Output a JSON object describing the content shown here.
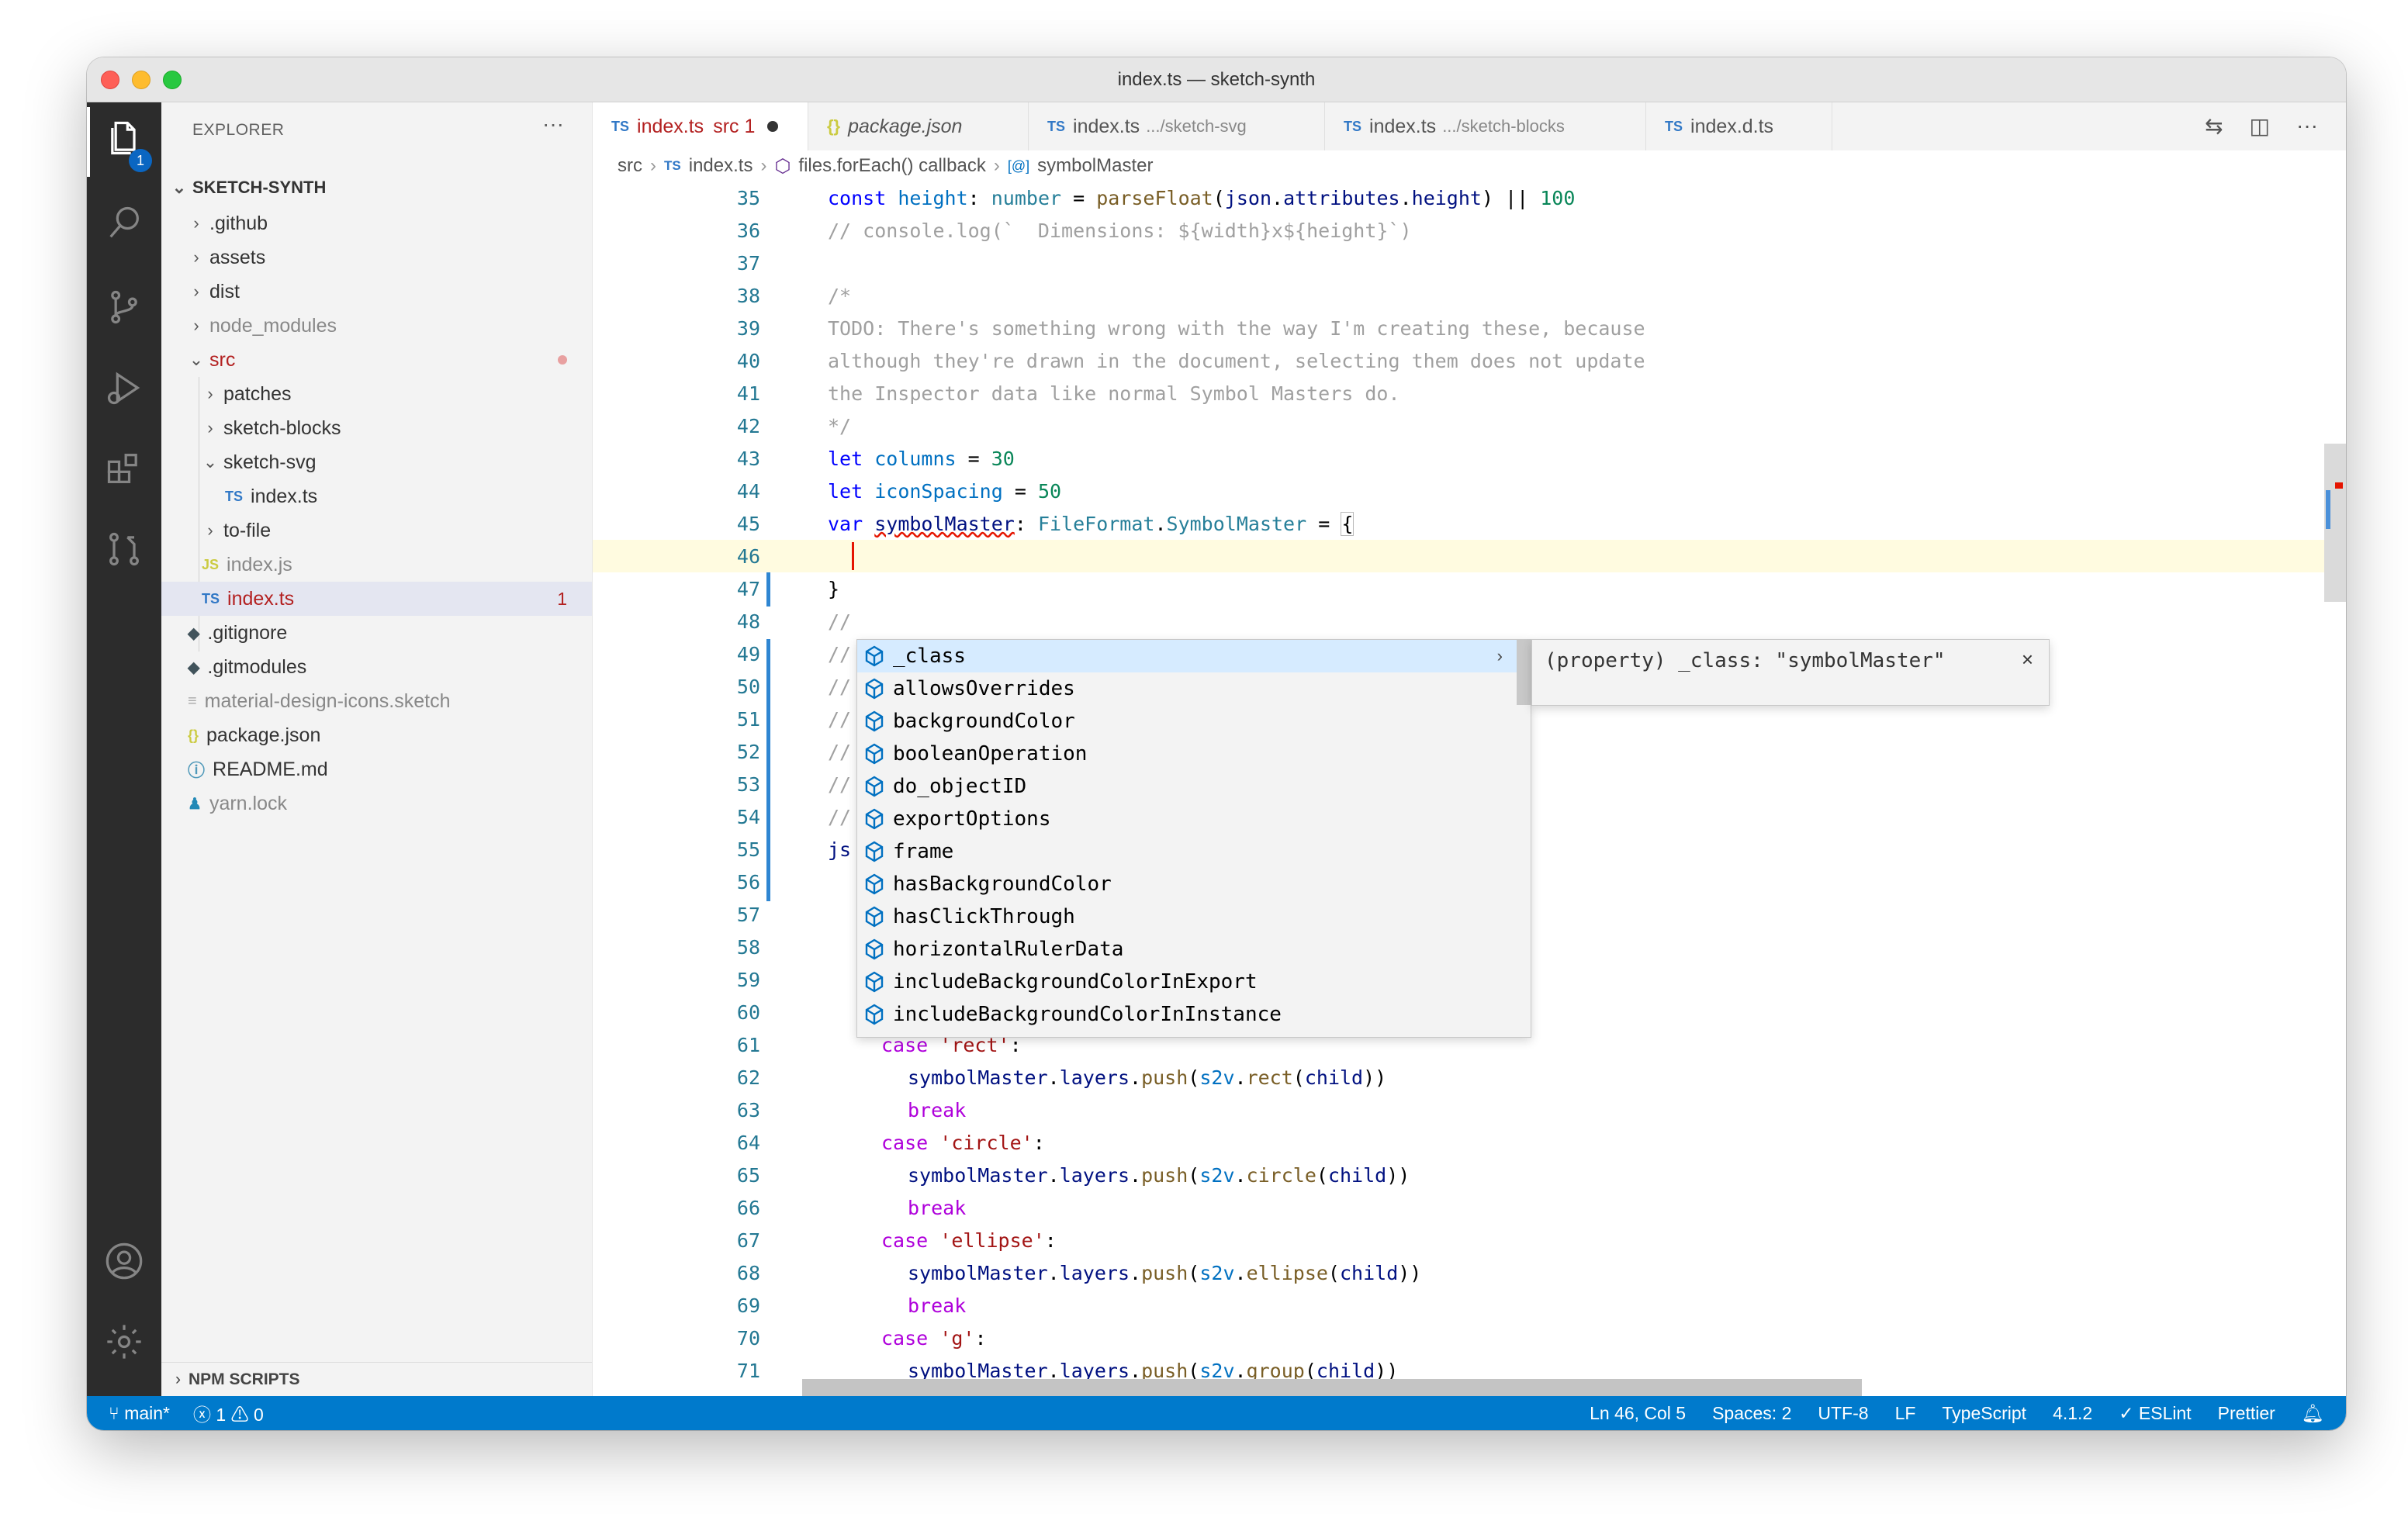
{
  "window": {
    "title": "index.ts — sketch-synth"
  },
  "activity_bar": {
    "explorer_badge": "1"
  },
  "sidebar": {
    "header": "EXPLORER",
    "more": "···",
    "workspace": "SKETCH-SYNTH",
    "tree": [
      {
        "label": ".github",
        "kind": "folder"
      },
      {
        "label": "assets",
        "kind": "folder"
      },
      {
        "label": "dist",
        "kind": "folder"
      },
      {
        "label": "node_modules",
        "kind": "folder"
      },
      {
        "label": "src",
        "kind": "folder-open"
      },
      {
        "label": "patches",
        "kind": "folder"
      },
      {
        "label": "sketch-blocks",
        "kind": "folder"
      },
      {
        "label": "sketch-svg",
        "kind": "folder-open"
      },
      {
        "label": "index.ts",
        "kind": "ts"
      },
      {
        "label": "to-file",
        "kind": "folder"
      },
      {
        "label": "index.js",
        "kind": "js"
      },
      {
        "label": "index.ts",
        "kind": "ts",
        "problems": "1"
      },
      {
        "label": ".gitignore",
        "kind": "git"
      },
      {
        "label": ".gitmodules",
        "kind": "git"
      },
      {
        "label": "material-design-icons.sketch",
        "kind": "file"
      },
      {
        "label": "package.json",
        "kind": "json"
      },
      {
        "label": "README.md",
        "kind": "info"
      },
      {
        "label": "yarn.lock",
        "kind": "yarn"
      }
    ],
    "npm_scripts": "NPM SCRIPTS"
  },
  "tabs": [
    {
      "icon": "TS",
      "label": "index.ts",
      "detail": "src 1",
      "active": true
    },
    {
      "icon": "{}",
      "label": "package.json",
      "detail": ""
    },
    {
      "icon": "TS",
      "label": "index.ts",
      "detail": ".../sketch-svg"
    },
    {
      "icon": "TS",
      "label": "index.ts",
      "detail": ".../sketch-blocks"
    },
    {
      "icon": "TS",
      "label": "index.d.ts",
      "detail": ""
    }
  ],
  "breadcrumb": {
    "items": [
      "src",
      "index.ts",
      "files.forEach() callback",
      "symbolMaster"
    ],
    "ts_icon": "TS"
  },
  "code": {
    "line_numbers": [
      "35",
      "36",
      "37",
      "38",
      "39",
      "40",
      "41",
      "42",
      "43",
      "44",
      "45",
      "46",
      "47",
      "48",
      "49",
      "50",
      "51",
      "52",
      "53",
      "54",
      "55",
      "56",
      "57",
      "58",
      "59",
      "60",
      "61",
      "62",
      "63",
      "64",
      "65",
      "66",
      "67",
      "68",
      "69",
      "70",
      "71"
    ],
    "comment_36": "// console.log(`  Dimensions: ${width}x${height}`)",
    "comment_38": "/*",
    "comment_39": "TODO: There's something wrong with the way I'm creating these, because",
    "comment_40": "although they're drawn in the document, selecting them does not update",
    "comment_41": "the Inspector data like normal Symbol Masters do.",
    "comment_42": "*/",
    "brace_47": "}",
    "prefix_48_54": "//",
    "prefix_55": "js"
  },
  "suggest": {
    "items": [
      "_class",
      "allowsOverrides",
      "backgroundColor",
      "booleanOperation",
      "do_objectID",
      "exportOptions",
      "frame",
      "hasBackgroundColor",
      "hasClickThrough",
      "horizontalRulerData",
      "includeBackgroundColorInExport",
      "includeBackgroundColorInInstance"
    ],
    "detail": "(property) _class: \"symbolMaster\"",
    "close": "×",
    "expand": "›"
  },
  "statusbar": {
    "branch": "main*",
    "errors": "1",
    "warnings": "0",
    "position": "Ln 46, Col 5",
    "spaces": "Spaces: 2",
    "encoding": "UTF-8",
    "eol": "LF",
    "language": "TypeScript",
    "ts_version": "4.1.2",
    "eslint": "ESLint",
    "prettier": "Prettier"
  },
  "colors": {
    "statusbar": "#007acc",
    "activity_bar": "#2c2c2c",
    "error_text": "#b32020",
    "keyword": "#0000ff"
  }
}
